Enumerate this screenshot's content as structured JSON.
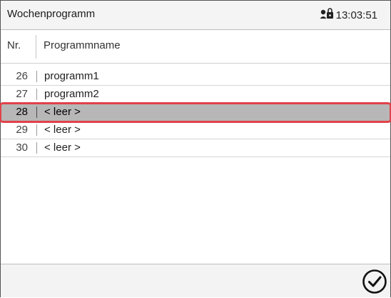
{
  "header": {
    "title": "Wochenprogramm",
    "time": "13:03:51",
    "status_icon": "user-key-icon"
  },
  "columns": {
    "nr": "Nr.",
    "name": "Programmname"
  },
  "rows": [
    {
      "nr": "26",
      "name": "programm1",
      "selected": false
    },
    {
      "nr": "27",
      "name": "programm2",
      "selected": false
    },
    {
      "nr": "28",
      "name": "< leer >",
      "selected": true
    },
    {
      "nr": "29",
      "name": "< leer >",
      "selected": false
    },
    {
      "nr": "30",
      "name": "< leer >",
      "selected": false
    }
  ],
  "footer": {
    "confirm_icon": "checkmark-circle-icon"
  },
  "colors": {
    "selection_fill": "#b7b7b7",
    "selection_outline": "#e0424a"
  }
}
